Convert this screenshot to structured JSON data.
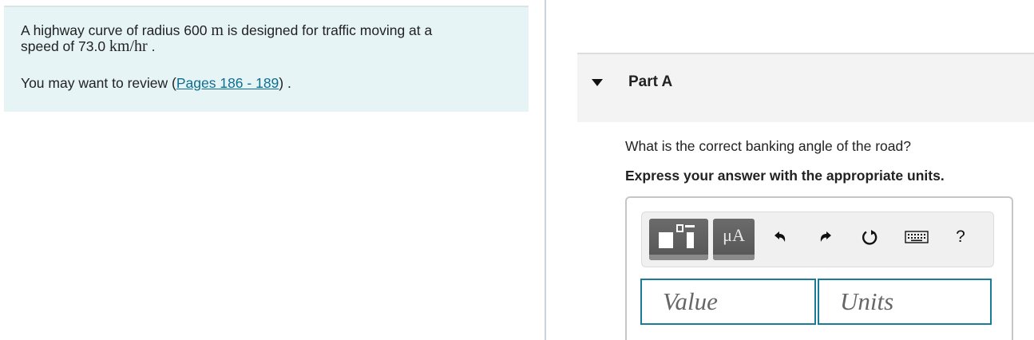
{
  "problem": {
    "line1_prefix": "A highway curve of radius 600 ",
    "radius_unit": "m",
    "line1_suffix": " is designed for traffic moving at a",
    "line2_prefix": "speed of 73.0 ",
    "speed_unit": "km/hr",
    "line2_suffix": " .",
    "review_prefix": "You may want to review (",
    "review_link": "Pages 186 - 189",
    "review_suffix": ") ."
  },
  "part": {
    "title": "Part A",
    "question": "What is the correct banking angle of the road?",
    "instruction": "Express your answer with the appropriate units."
  },
  "toolbar": {
    "symbols_label": "μA",
    "help_label": "?",
    "icons": [
      "templates-icon",
      "symbols-icon",
      "undo-icon",
      "redo-icon",
      "reset-icon",
      "keyboard-icon",
      "help-icon"
    ]
  },
  "answer": {
    "value_placeholder": "Value",
    "units_placeholder": "Units",
    "value": "",
    "units": ""
  },
  "colors": {
    "problem_bg": "#e6f4f5",
    "link": "#0e6e8f",
    "field_border": "#1a7b9a",
    "toolbar_button": "#5f5f5f"
  }
}
